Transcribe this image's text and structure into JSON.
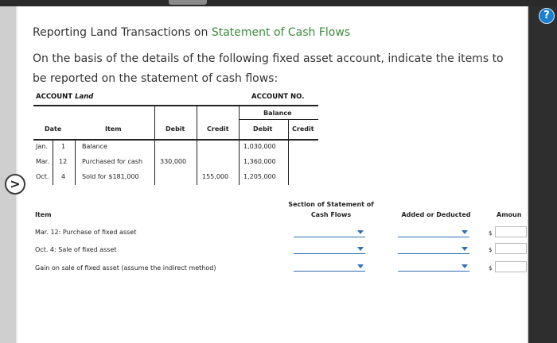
{
  "title": {
    "prefix": "Reporting Land Transactions on ",
    "link": "Statement of Cash Flows"
  },
  "instructions": "On the basis of the details of the following fixed asset account, indicate the items to be reported on the statement of cash flows:",
  "help_icon": "?",
  "nav_icon": ">",
  "account": {
    "label_prefix": "ACCOUNT ",
    "name": "Land",
    "no_label": "ACCOUNT NO."
  },
  "ledger": {
    "balance_header": "Balance",
    "headers": {
      "date": "Date",
      "item": "Item",
      "debit": "Debit",
      "credit": "Credit",
      "bal_debit": "Debit",
      "bal_credit": "Credit"
    },
    "rows": [
      {
        "month": "Jan.",
        "day": "1",
        "item": "Balance",
        "debit": "",
        "credit": "",
        "bal_debit": "1,030,000",
        "bal_credit": ""
      },
      {
        "month": "Mar.",
        "day": "12",
        "item": "Purchased for cash",
        "debit": "330,000",
        "credit": "",
        "bal_debit": "1,360,000",
        "bal_credit": ""
      },
      {
        "month": "Oct.",
        "day": "4",
        "item": "Sold for $181,000",
        "debit": "",
        "credit": "155,000",
        "bal_debit": "1,205,000",
        "bal_credit": ""
      }
    ]
  },
  "answer": {
    "headers": {
      "item": "Item",
      "section": "Section of Statement of Cash Flows",
      "section_line1": "Section of Statement of",
      "section_line2": "Cash Flows",
      "added": "Added or Deducted",
      "amount": "Amoun"
    },
    "rows": [
      {
        "label": "Mar. 12: Purchase of fixed asset",
        "section": "",
        "added": "",
        "dollar": "$",
        "amount": ""
      },
      {
        "label": "Oct. 4: Sale of fixed asset",
        "section": "",
        "added": "",
        "dollar": "$",
        "amount": ""
      },
      {
        "label": "Gain on sale of fixed asset (assume the indirect method)",
        "section": "",
        "added": "",
        "dollar": "$",
        "amount": ""
      }
    ]
  },
  "colors": {
    "link": "#3a8a3a",
    "dropdown": "#2f6fb5",
    "help": "#1a7fd0"
  }
}
